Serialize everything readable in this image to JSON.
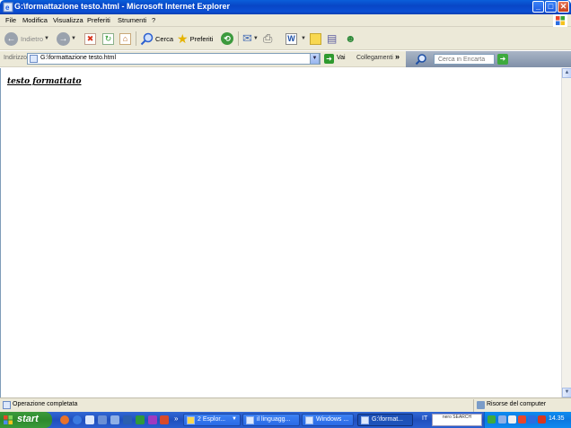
{
  "window": {
    "title": "G:\\formattazione testo.html - Microsoft Internet Explorer",
    "minimize_label": "_",
    "maximize_label": "□",
    "close_label": "✕"
  },
  "menu": {
    "items": [
      "File",
      "Modifica",
      "Visualizza",
      "Preferiti",
      "Strumenti",
      "?"
    ]
  },
  "toolbar": {
    "back_label": "Indietro",
    "search_label": "Cerca",
    "favorites_label": "Preferiti",
    "word_label": "W"
  },
  "address": {
    "label": "Indirizzo",
    "url": "G:\\formattazione testo.html",
    "go_label": "Vai",
    "links_label": "Collegamenti",
    "links_chevron": "»",
    "search_placeholder": "Cerca in Encarta"
  },
  "page": {
    "heading": "testo formattato"
  },
  "status": {
    "text": "Operazione completata",
    "zone": "Risorse del computer"
  },
  "taskbar": {
    "start_label": "start",
    "tasks": [
      {
        "label": "2 Esplor...",
        "has_arrow": true
      },
      {
        "label": "il linguagg...",
        "has_arrow": false
      },
      {
        "label": "Windows ...",
        "has_arrow": false
      },
      {
        "label": "G:\\format...",
        "has_arrow": false
      }
    ],
    "language": "IT",
    "nero_label": "nero SEARCH",
    "clock": "14.35"
  },
  "colors": {
    "titlebar": "#0a5fd9",
    "taskbar": "#2b5fd0",
    "start": "#3c9a3c",
    "chrome": "#ece9d8"
  }
}
